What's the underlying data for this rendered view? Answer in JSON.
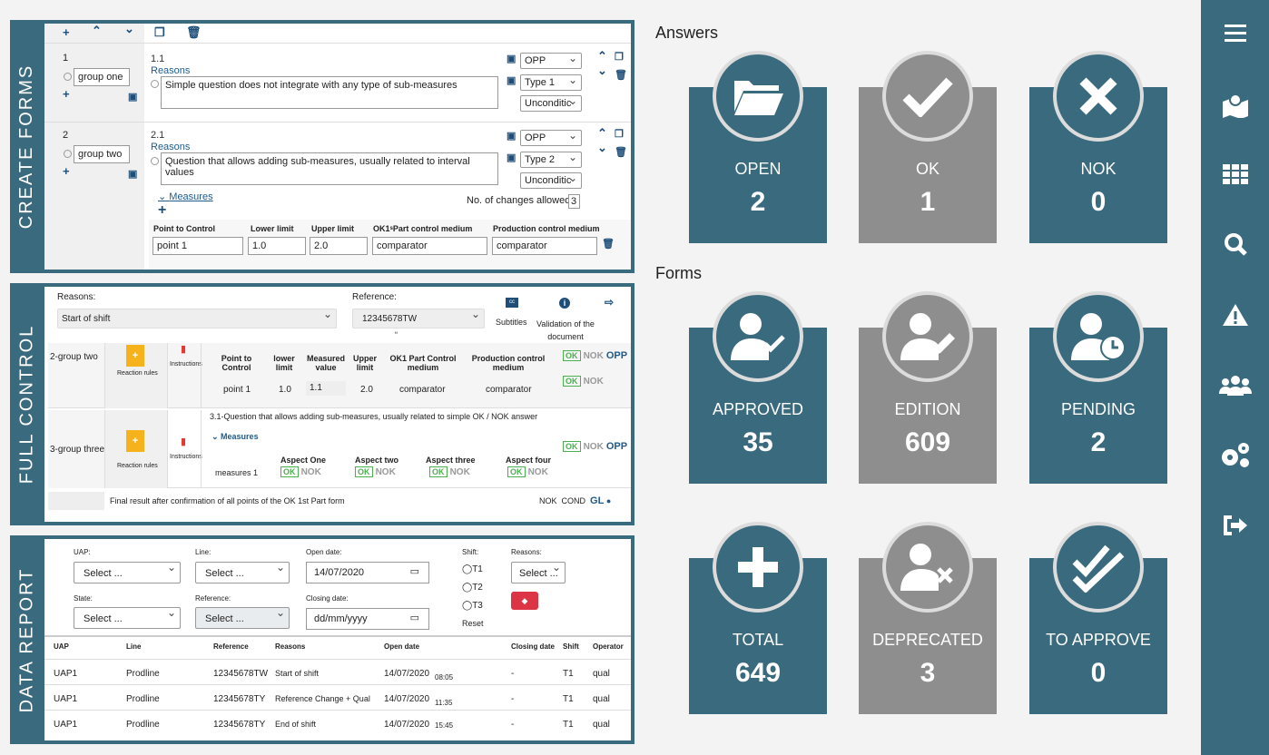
{
  "create_forms": {
    "label": "CREATE FORMS",
    "groups": [
      {
        "num": "1",
        "name": "group one",
        "qnum": "1.1",
        "reasons": "Reasons",
        "question": "Simple question does not integrate with any type of sub-measures",
        "opt1": "OPP",
        "opt2": "Type 1",
        "opt3": "Unconditic"
      },
      {
        "num": "2",
        "name": "group two",
        "qnum": "2.1",
        "reasons": "Reasons",
        "question": "Question that allows adding sub-measures, usually related to interval values",
        "opt1": "OPP",
        "opt2": "Type 2",
        "opt3": "Unconditic"
      }
    ],
    "measures_link": "Measures",
    "changes_label": "No. of changes allowed:",
    "changes_value": "3",
    "headers": [
      "Point to Control",
      "Lower limit",
      "Upper limit",
      "OK1ˢPart control medium",
      "Production control medium"
    ],
    "row": [
      "point 1",
      "1.0",
      "2.0",
      "comparator",
      "comparator"
    ]
  },
  "full_control": {
    "label": "FULL CONTROL",
    "reasons_label": "Reasons:",
    "reasons_value": "Start of shift",
    "reference_label": "Reference:",
    "reference_value": "12345678TW",
    "subtitles": "Subtitles",
    "validation": "Validation of the document",
    "quote": "“",
    "g2": "2-group two",
    "g3": "3-group three",
    "reaction": "Reaction rules",
    "instructions": "Instructions",
    "headers": [
      "Point to Control",
      "lower limit",
      "Measured value",
      "Upper limit",
      "OK1 Part Control medium",
      "Production control medium"
    ],
    "row": [
      "point 1",
      "1.0",
      "1.1",
      "2.0",
      "comparator",
      "comparator"
    ],
    "q3": "3.1-Question that allows adding sub-measures, usually related to simple OK / NOK answer",
    "measures": "Measures",
    "aspects": [
      "Aspect One",
      "Aspect two",
      "Aspect three",
      "Aspect four"
    ],
    "measures1": "measures 1",
    "ok": "OK",
    "nok": "NOK",
    "opp": "OPP",
    "final": "Final result after confirmation of all points of the OK 1st Part form",
    "final_nok": "NOK",
    "final_cond": "COND",
    "final_gl": "GL"
  },
  "data_report": {
    "label": "DATA REPORT",
    "uap": "UAP:",
    "line": "Line:",
    "open_date": "Open date:",
    "shift": "Shift:",
    "reasons": "Reasons:",
    "state": "State:",
    "reference": "Reference:",
    "closing_date": "Closing date:",
    "select": "Select ...",
    "open_value": "14/07/2020",
    "closing_placeholder": "dd/mm/yyyy",
    "t1": "T1",
    "t2": "T2",
    "t3": "T3",
    "reset": "Reset",
    "columns": [
      "UAP",
      "Line",
      "Reference",
      "Reasons",
      "Open date",
      "Closing date",
      "Shift",
      "Operator"
    ],
    "rows": [
      [
        "UAP1",
        "Prodline",
        "12345678TW",
        "Start of shift",
        "14/07/2020",
        "08:05",
        "-",
        "T1",
        "qual"
      ],
      [
        "UAP1",
        "Prodline",
        "12345678TY",
        "Reference Change + Qual",
        "14/07/2020",
        "11:35",
        "-",
        "T1",
        "qual"
      ],
      [
        "UAP1",
        "Prodline",
        "12345678TY",
        "End of shift",
        "14/07/2020",
        "15:45",
        "-",
        "T1",
        "qual"
      ]
    ]
  },
  "answers": {
    "title": "Answers",
    "cards": [
      {
        "label": "OPEN",
        "value": "2"
      },
      {
        "label": "OK",
        "value": "1"
      },
      {
        "label": "NOK",
        "value": "0"
      }
    ]
  },
  "forms": {
    "title": "Forms",
    "cards": [
      {
        "label": "APPROVED",
        "value": "35"
      },
      {
        "label": "EDITION",
        "value": "609"
      },
      {
        "label": "PENDING",
        "value": "2"
      },
      {
        "label": "TOTAL",
        "value": "649"
      },
      {
        "label": "DEPRECATED",
        "value": "3"
      },
      {
        "label": "TO APPROVE",
        "value": "0"
      }
    ]
  },
  "sidebar_icons": [
    "menu-icon",
    "map-icon",
    "grid-icon",
    "search-icon",
    "warning-icon",
    "users-icon",
    "settings-icon",
    "logout-icon"
  ],
  "colors": {
    "teal": "#3a6a7e",
    "grey": "#8e8e8e",
    "ok_green": "#4caf50"
  }
}
